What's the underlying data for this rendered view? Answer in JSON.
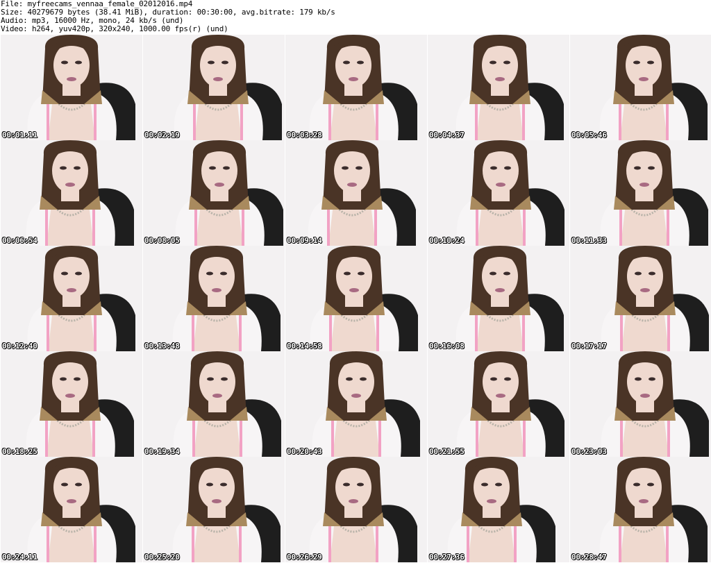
{
  "header": {
    "file_line": "File: myfreecams_vennaa_female_02012016.mp4",
    "size_line": "Size: 40279679 bytes (38.41 MiB), duration: 00:30:00, avg.bitrate: 179 kb/s",
    "audio_line": "Audio: mp3, 16000 Hz, mono, 24 kb/s (und)",
    "video_line": "Video: h264, yuv420p, 320x240, 1000.00 fps(r) (und)"
  },
  "thumbnails": [
    {
      "timestamp": "00:01:11"
    },
    {
      "timestamp": "00:02:19"
    },
    {
      "timestamp": "00:03:28"
    },
    {
      "timestamp": "00:04:37"
    },
    {
      "timestamp": "00:05:46"
    },
    {
      "timestamp": "00:06:54"
    },
    {
      "timestamp": "00:08:05"
    },
    {
      "timestamp": "00:09:14"
    },
    {
      "timestamp": "00:10:24"
    },
    {
      "timestamp": "00:11:33"
    },
    {
      "timestamp": "00:12:40"
    },
    {
      "timestamp": "00:13:48"
    },
    {
      "timestamp": "00:14:58"
    },
    {
      "timestamp": "00:16:08"
    },
    {
      "timestamp": "00:17:17"
    },
    {
      "timestamp": "00:18:25"
    },
    {
      "timestamp": "00:19:34"
    },
    {
      "timestamp": "00:20:43"
    },
    {
      "timestamp": "00:21:55"
    },
    {
      "timestamp": "00:23:03"
    },
    {
      "timestamp": "00:24:11"
    },
    {
      "timestamp": "00:25:20"
    },
    {
      "timestamp": "00:26:29"
    },
    {
      "timestamp": "00:27:36"
    },
    {
      "timestamp": "00:28:47"
    }
  ],
  "colors": {
    "background": "#ffffff",
    "frame_bg": "#f3f1f2",
    "hair": "#4a3426",
    "hair_tips": "#a98a5e",
    "skin": "#efd9cf",
    "sweater": "#f7f5f6",
    "strap": "#f2a2c4",
    "chair": "#1e1e1e",
    "timestamp_text": "#ffffff",
    "timestamp_outline": "#000000"
  }
}
